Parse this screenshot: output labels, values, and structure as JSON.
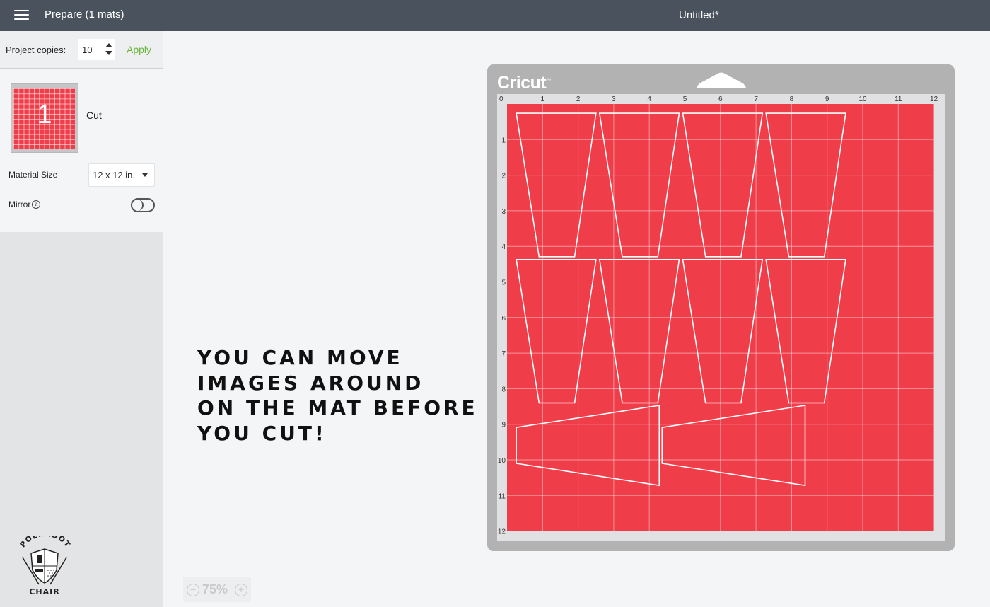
{
  "topbar": {
    "menu_icon": "hamburger-menu-icon",
    "prepare_label": "Prepare (1 mats)",
    "document_title": "Untitled*"
  },
  "sidebar": {
    "project_copies_label": "Project copies:",
    "project_copies_value": "10",
    "apply_label": "Apply",
    "mat": {
      "number": "1",
      "operation": "Cut"
    },
    "material_size_label": "Material Size",
    "material_size_value": "12 x 12 in.",
    "mirror_label": "Mirror",
    "mirror_info_icon": "i",
    "mirror_on": false,
    "logo": {
      "top_text": "POLKADOT",
      "bottom_text": "CHAIR"
    }
  },
  "canvas": {
    "annotation": "YOU CAN MOVE\nIMAGES AROUND\nON THE MAT BEFORE\nYOU CUT!",
    "zoom_minus": "−",
    "zoom_level": "75%",
    "zoom_plus": "+",
    "mat": {
      "brand": "Cricut",
      "trademark": "™",
      "color": "#ef3e4a",
      "ruler_x": [
        "0",
        "1",
        "2",
        "3",
        "4",
        "5",
        "6",
        "7",
        "8",
        "9",
        "10",
        "11",
        "12"
      ],
      "ruler_y": [
        "1",
        "2",
        "3",
        "4",
        "5",
        "6",
        "7",
        "8",
        "9",
        "10",
        "11",
        "12"
      ],
      "size_in": 12,
      "shapes_in": [
        [
          [
            0.26,
            0.26
          ],
          [
            2.5,
            0.26
          ],
          [
            1.9,
            4.29
          ],
          [
            0.9,
            4.29
          ]
        ],
        [
          [
            2.6,
            0.26
          ],
          [
            4.84,
            0.26
          ],
          [
            4.24,
            4.29
          ],
          [
            3.24,
            4.29
          ]
        ],
        [
          [
            4.94,
            0.26
          ],
          [
            7.18,
            0.26
          ],
          [
            6.58,
            4.29
          ],
          [
            5.58,
            4.29
          ]
        ],
        [
          [
            7.28,
            0.26
          ],
          [
            9.52,
            0.26
          ],
          [
            8.92,
            4.29
          ],
          [
            7.92,
            4.29
          ]
        ],
        [
          [
            0.26,
            4.37
          ],
          [
            2.5,
            4.37
          ],
          [
            1.9,
            8.4
          ],
          [
            0.9,
            8.4
          ]
        ],
        [
          [
            2.6,
            4.37
          ],
          [
            4.84,
            4.37
          ],
          [
            4.24,
            8.4
          ],
          [
            3.24,
            8.4
          ]
        ],
        [
          [
            4.94,
            4.37
          ],
          [
            7.18,
            4.37
          ],
          [
            6.58,
            8.4
          ],
          [
            5.58,
            8.4
          ]
        ],
        [
          [
            7.28,
            4.37
          ],
          [
            9.52,
            4.37
          ],
          [
            8.92,
            8.4
          ],
          [
            7.92,
            8.4
          ]
        ],
        [
          [
            0.26,
            9.09
          ],
          [
            4.28,
            8.47
          ],
          [
            4.28,
            10.72
          ],
          [
            0.26,
            10.1
          ]
        ],
        [
          [
            4.36,
            9.09
          ],
          [
            8.38,
            8.47
          ],
          [
            8.38,
            10.72
          ],
          [
            4.36,
            10.1
          ]
        ]
      ]
    }
  }
}
